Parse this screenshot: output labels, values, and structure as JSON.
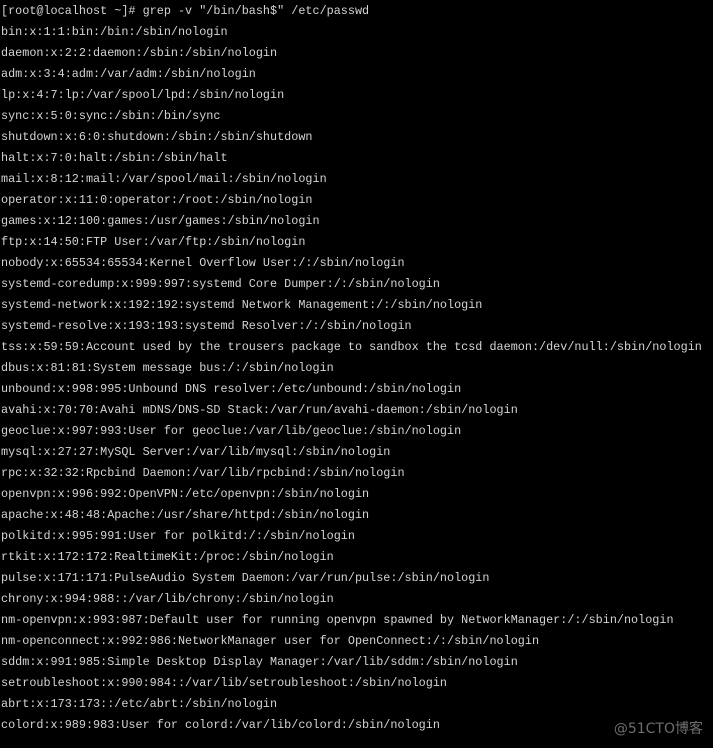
{
  "terminal": {
    "background": "#000000",
    "foreground": "#d4d4d4",
    "lines": [
      "[root@localhost ~]# grep -v \"/bin/bash$\" /etc/passwd",
      "bin:x:1:1:bin:/bin:/sbin/nologin",
      "daemon:x:2:2:daemon:/sbin:/sbin/nologin",
      "adm:x:3:4:adm:/var/adm:/sbin/nologin",
      "lp:x:4:7:lp:/var/spool/lpd:/sbin/nologin",
      "sync:x:5:0:sync:/sbin:/bin/sync",
      "shutdown:x:6:0:shutdown:/sbin:/sbin/shutdown",
      "halt:x:7:0:halt:/sbin:/sbin/halt",
      "mail:x:8:12:mail:/var/spool/mail:/sbin/nologin",
      "operator:x:11:0:operator:/root:/sbin/nologin",
      "games:x:12:100:games:/usr/games:/sbin/nologin",
      "ftp:x:14:50:FTP User:/var/ftp:/sbin/nologin",
      "nobody:x:65534:65534:Kernel Overflow User:/:/sbin/nologin",
      "systemd-coredump:x:999:997:systemd Core Dumper:/:/sbin/nologin",
      "systemd-network:x:192:192:systemd Network Management:/:/sbin/nologin",
      "systemd-resolve:x:193:193:systemd Resolver:/:/sbin/nologin",
      "tss:x:59:59:Account used by the trousers package to sandbox the tcsd daemon:/dev/null:/sbin/nologin",
      "dbus:x:81:81:System message bus:/:/sbin/nologin",
      "unbound:x:998:995:Unbound DNS resolver:/etc/unbound:/sbin/nologin",
      "avahi:x:70:70:Avahi mDNS/DNS-SD Stack:/var/run/avahi-daemon:/sbin/nologin",
      "geoclue:x:997:993:User for geoclue:/var/lib/geoclue:/sbin/nologin",
      "mysql:x:27:27:MySQL Server:/var/lib/mysql:/sbin/nologin",
      "rpc:x:32:32:Rpcbind Daemon:/var/lib/rpcbind:/sbin/nologin",
      "openvpn:x:996:992:OpenVPN:/etc/openvpn:/sbin/nologin",
      "apache:x:48:48:Apache:/usr/share/httpd:/sbin/nologin",
      "polkitd:x:995:991:User for polkitd:/:/sbin/nologin",
      "rtkit:x:172:172:RealtimeKit:/proc:/sbin/nologin",
      "pulse:x:171:171:PulseAudio System Daemon:/var/run/pulse:/sbin/nologin",
      "chrony:x:994:988::/var/lib/chrony:/sbin/nologin",
      "nm-openvpn:x:993:987:Default user for running openvpn spawned by NetworkManager:/:/sbin/nologin",
      "nm-openconnect:x:992:986:NetworkManager user for OpenConnect:/:/sbin/nologin",
      "sddm:x:991:985:Simple Desktop Display Manager:/var/lib/sddm:/sbin/nologin",
      "setroubleshoot:x:990:984::/var/lib/setroubleshoot:/sbin/nologin",
      "abrt:x:173:173::/etc/abrt:/sbin/nologin",
      "colord:x:989:983:User for colord:/var/lib/colord:/sbin/nologin"
    ]
  },
  "watermark": "@51CTO博客"
}
